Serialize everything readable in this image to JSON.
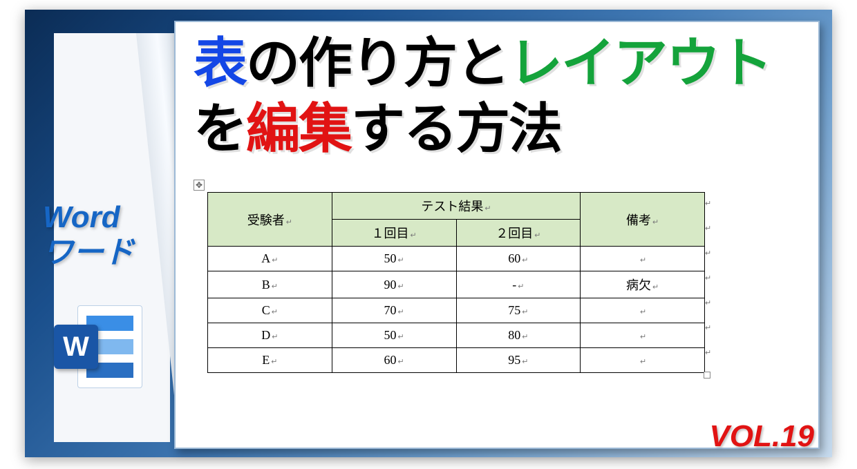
{
  "left": {
    "app_en": "Word",
    "app_ja": "ワード",
    "icon_letter": "W"
  },
  "title": {
    "l1_blue": "表",
    "l1_black1": "の作り方と",
    "l1_green": "レイアウト",
    "l2_black1": "を",
    "l2_red": "編集",
    "l2_black2": "する方法"
  },
  "volume": "VOL.19",
  "table": {
    "headers": {
      "examinee": "受験者",
      "test_results": "テスト結果",
      "first": "１回目",
      "second": "２回目",
      "remarks": "備考"
    },
    "rows": [
      {
        "name": "A",
        "r1": "50",
        "r2": "60",
        "note": ""
      },
      {
        "name": "B",
        "r1": "90",
        "r2": "-",
        "note": "病欠"
      },
      {
        "name": "C",
        "r1": "70",
        "r2": "75",
        "note": ""
      },
      {
        "name": "D",
        "r1": "50",
        "r2": "80",
        "note": ""
      },
      {
        "name": "E",
        "r1": "60",
        "r2": "95",
        "note": ""
      }
    ]
  },
  "move_handle_glyph": "✥"
}
